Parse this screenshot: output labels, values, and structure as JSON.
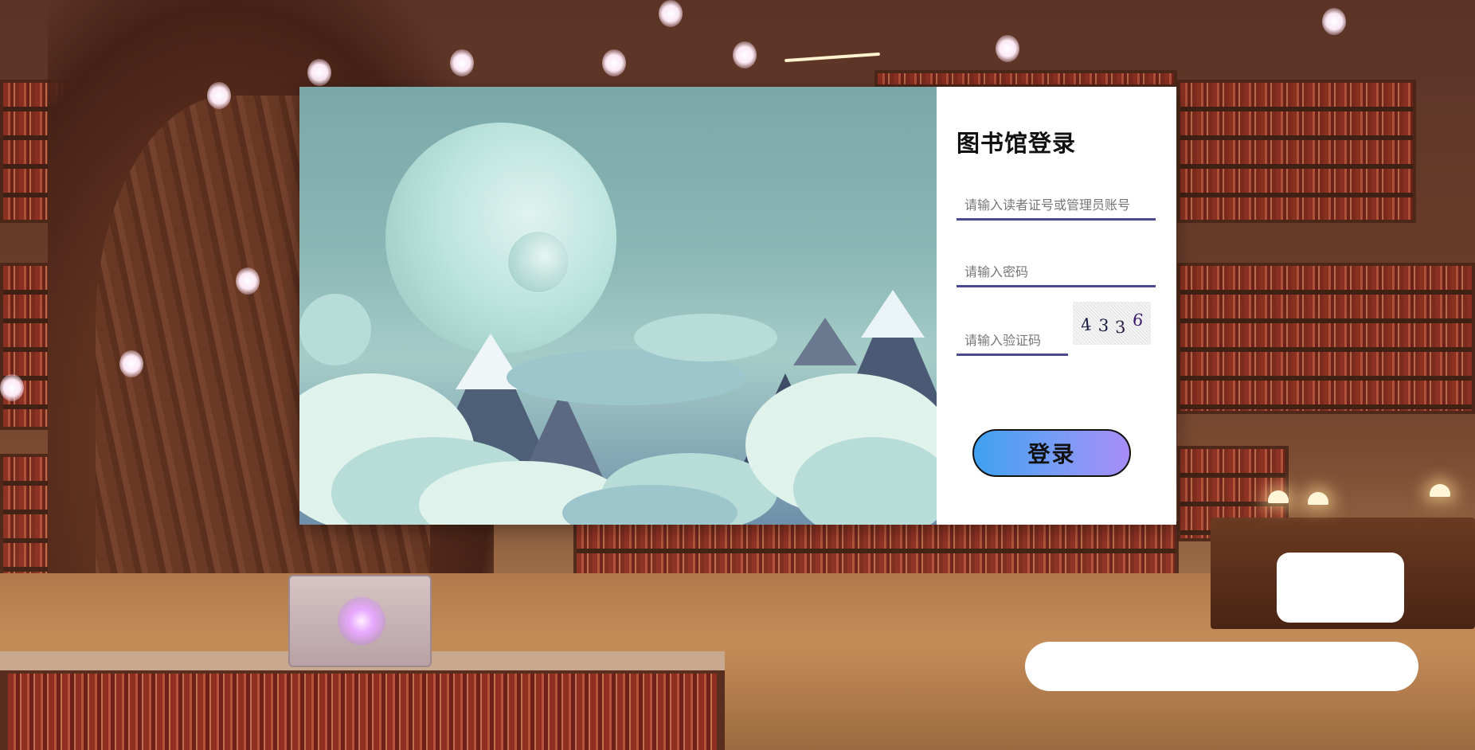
{
  "login": {
    "title": "图书馆登录",
    "account_placeholder": "请输入读者证号或管理员账号",
    "password_placeholder": "请输入密码",
    "captcha_placeholder": "请输入验证码",
    "captcha_chars": [
      "4",
      "3",
      "3",
      "6"
    ],
    "submit_label": "登录"
  },
  "colors": {
    "field_underline": "#4b4a90",
    "button_gradient_start": "#3fa0f0",
    "button_gradient_end": "#a78cf6",
    "form_background": "#ffffff"
  },
  "icons": [
    "captcha-image"
  ]
}
